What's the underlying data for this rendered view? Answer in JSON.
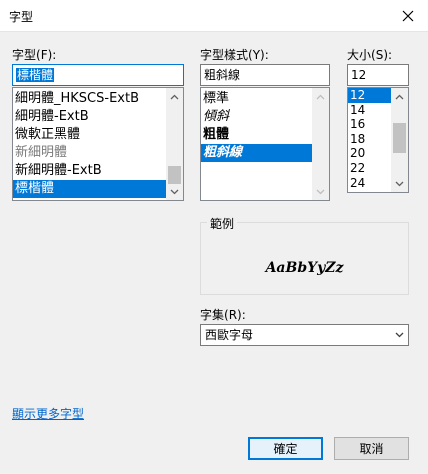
{
  "dialog": {
    "title": "字型",
    "close_icon": "close-icon"
  },
  "font": {
    "label": "字型",
    "accel": "(F):",
    "value": "標楷體",
    "items": [
      {
        "label": "細明體_HKSCS-ExtB",
        "state": "normal"
      },
      {
        "label": "細明體-ExtB",
        "state": "normal"
      },
      {
        "label": "微軟正黑體",
        "state": "normal"
      },
      {
        "label": "新細明體",
        "state": "gray"
      },
      {
        "label": "新細明體-ExtB",
        "state": "normal"
      },
      {
        "label": "標楷體",
        "state": "selected"
      }
    ]
  },
  "style": {
    "label": "字型樣式",
    "accel": "(Y):",
    "value": "粗斜線",
    "items": [
      {
        "label": "標準",
        "state": "normal"
      },
      {
        "label": "傾斜",
        "state": "normal"
      },
      {
        "label": "粗體",
        "state": "normal"
      },
      {
        "label": "粗斜線",
        "state": "selected"
      }
    ]
  },
  "size": {
    "label": "大小",
    "accel": "(S):",
    "value": "12",
    "items": [
      {
        "label": "12",
        "state": "selected"
      },
      {
        "label": "14",
        "state": "normal"
      },
      {
        "label": "16",
        "state": "normal"
      },
      {
        "label": "18",
        "state": "normal"
      },
      {
        "label": "20",
        "state": "normal"
      },
      {
        "label": "22",
        "state": "normal"
      },
      {
        "label": "24",
        "state": "normal"
      }
    ]
  },
  "sample": {
    "title": "範例",
    "text": "AaBbYyZz"
  },
  "script": {
    "label": "字集",
    "accel": "(R):",
    "value": "西歐字母"
  },
  "more_fonts_link": "顯示更多字型",
  "buttons": {
    "ok": "確定",
    "cancel": "取消"
  },
  "colors": {
    "accent": "#0078d7",
    "link": "#0066cc",
    "background": "#f0f0f0"
  }
}
